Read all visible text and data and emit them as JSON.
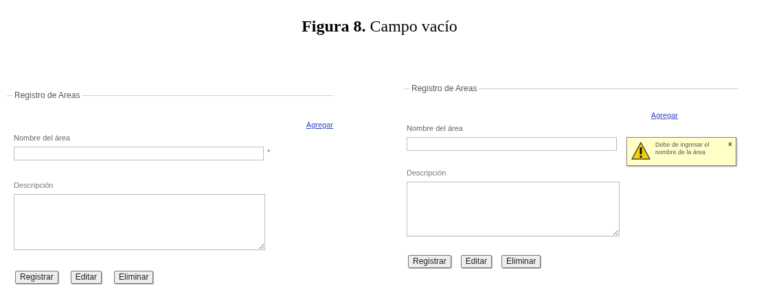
{
  "caption": "**Figura 8.** Campo vacío",
  "panels": [
    {
      "legend": "Registro de Areas",
      "add_link": "Agregar",
      "name_label": "Nombre del área",
      "required_marker": "*",
      "description_label": "Descripción",
      "buttons": [
        "Registrar",
        "Editar",
        "Eliminar"
      ]
    },
    {
      "legend": "Registro de Areas",
      "add_link": "Agregar",
      "name_label": "Nombre del área",
      "description_label": "Descripción",
      "buttons": [
        "Registrar",
        "Editar",
        "Eliminar"
      ],
      "tooltip": {
        "message": "Debe de ingresar el nombre de la área",
        "close": "×"
      }
    }
  ]
}
